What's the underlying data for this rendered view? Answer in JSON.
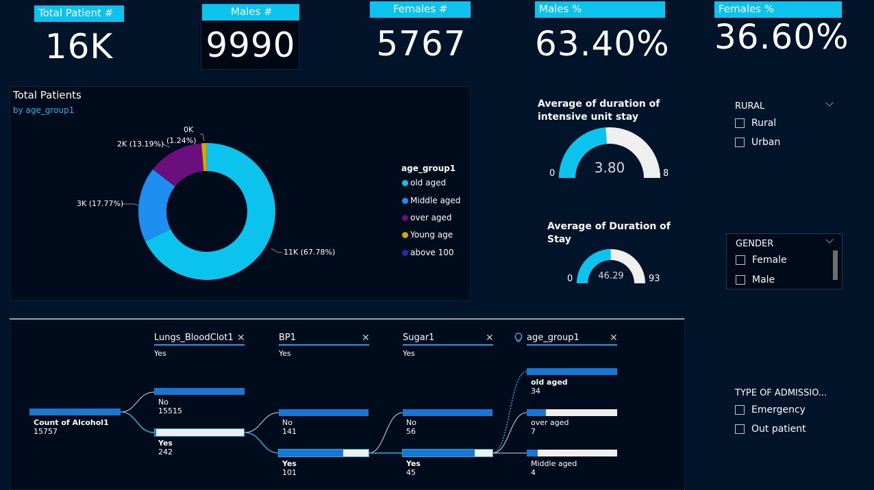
{
  "kpis": {
    "total_patient_label": "Total Patient #",
    "total_patient_value": "16K",
    "males_label": "Males #",
    "males_value": "9990",
    "females_label": "Females #",
    "females_value": "5767",
    "males_pct_label": "Males %",
    "males_pct_value": "63.40%",
    "females_pct_label": "Females %",
    "females_pct_value": "36.60%"
  },
  "donut": {
    "title": "Total Patients",
    "subtitle": "by age_group1",
    "legend_title": "age_group1",
    "legend": [
      {
        "name": "old aged",
        "color": "#0cc3ee"
      },
      {
        "name": "Middle aged",
        "color": "#1f8ef1"
      },
      {
        "name": "over aged",
        "color": "#6b0f7e"
      },
      {
        "name": "Young age",
        "color": "#d4a600"
      },
      {
        "name": "above 100",
        "color": "#1a2fb0"
      }
    ],
    "labels": {
      "old": "11K (67.78%)",
      "middle": "3K (17.77%)",
      "over": "2K (13.19%)",
      "young_top": "0K",
      "young_bottom": "(1.24%)"
    }
  },
  "chart_data": {
    "type": "pie",
    "title": "Total Patients",
    "subtitle": "by age_group1",
    "categories": [
      "old aged",
      "Middle aged",
      "over aged",
      "Young age",
      "above 100"
    ],
    "values": [
      67.78,
      17.77,
      13.19,
      1.24,
      0.02
    ],
    "value_labels": [
      "11K (67.78%)",
      "3K (17.77%)",
      "2K (13.19%)",
      "0K (1.24%)",
      ""
    ],
    "legend_title": "age_group1",
    "legend_position": "right",
    "donut": true
  },
  "gauges": {
    "icu": {
      "title_line1": "Average of duration of",
      "title_line2": "intensive unit stay",
      "value": "3.80",
      "min": "0",
      "max": "8",
      "fraction": 0.475
    },
    "stay": {
      "title_line1": "Average of Duration of",
      "title_line2": "Stay",
      "value": "46.29",
      "min": "0",
      "max": "93",
      "fraction": 0.4977
    }
  },
  "slicers": {
    "rural": {
      "title": "RURAL",
      "options": [
        "Rural",
        "Urban"
      ]
    },
    "gender": {
      "title": "GENDER",
      "options": [
        "Female",
        "Male"
      ]
    },
    "admission": {
      "title": "TYPE OF ADMISSIO...",
      "options": [
        "Emergency",
        "Out patient"
      ]
    }
  },
  "decomposition": {
    "headers": [
      {
        "name": "Lungs_BloodClot1",
        "value": "Yes"
      },
      {
        "name": "BP1",
        "value": "Yes"
      },
      {
        "name": "Sugar1",
        "value": "Yes"
      },
      {
        "name": "age_group1",
        "value": ""
      }
    ],
    "root": {
      "label": "Count of Alcohol1",
      "value": "15757"
    },
    "lungs": [
      {
        "label": "No",
        "value": "15515",
        "fraction": 1.0
      },
      {
        "label": "Yes",
        "value": "242",
        "fraction": 0.016
      }
    ],
    "bp": [
      {
        "label": "No",
        "value": "141",
        "fraction": 1.0
      },
      {
        "label": "Yes",
        "value": "101",
        "fraction": 0.72
      }
    ],
    "sugar": [
      {
        "label": "No",
        "value": "56",
        "fraction": 1.0
      },
      {
        "label": "Yes",
        "value": "45",
        "fraction": 0.8
      }
    ],
    "age": [
      {
        "label": "old aged",
        "value": "34",
        "fraction": 1.0
      },
      {
        "label": "over aged",
        "value": "7",
        "fraction": 0.21
      },
      {
        "label": "Middle aged",
        "value": "4",
        "fraction": 0.12
      }
    ]
  }
}
